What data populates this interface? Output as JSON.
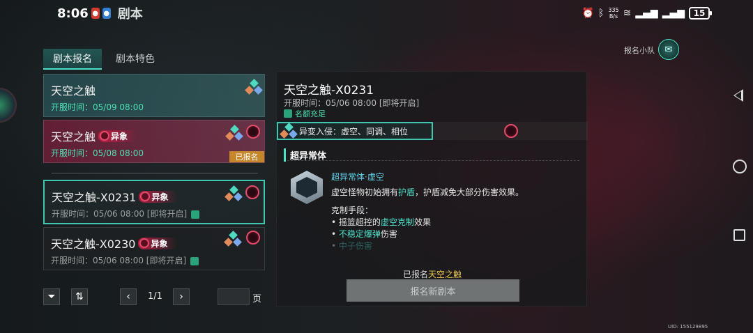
{
  "status_bar": {
    "time": "8:06",
    "net_speed_value": "335",
    "net_speed_unit": "B/s",
    "battery": "15"
  },
  "app": {
    "title": "剧本"
  },
  "tabs": [
    {
      "label": "剧本报名",
      "active": true
    },
    {
      "label": "剧本特色",
      "active": false
    }
  ],
  "scripts": [
    {
      "name": "天空之触",
      "time": "开服时间：05/09 08:00",
      "abnormal": "",
      "registered": ""
    },
    {
      "name": "天空之触",
      "time": "开服时间：05/08 08:00",
      "abnormal": "异象",
      "registered": "已报名"
    },
    {
      "name": "天空之触-X0231",
      "time": "开服时间：05/06 08:00 [即将开启]",
      "abnormal": "异象",
      "registered": ""
    },
    {
      "name": "天空之触-X0230",
      "time": "开服时间：05/06 08:00 [即将开启]",
      "abnormal": "异象",
      "registered": ""
    }
  ],
  "pagination": {
    "current": "1/1",
    "unit": "页"
  },
  "detail": {
    "title": "天空之触-X0231",
    "time": "开服时间：05/06 08:00",
    "status": "[即将开启]",
    "quota": "名额充足",
    "invasion": "异变入侵：虚空、同调、相位",
    "section_title": "超异常体",
    "ability_name": "超异常体·虚空",
    "desc_prefix": "虚空怪物初始拥有",
    "desc_highlight": "护盾",
    "desc_suffix": "，护盾减免大部分伤害效果。",
    "counter_title": "克制手段：",
    "counter_1_prefix": "摇篮超控的",
    "counter_1_highlight": "虚空克制",
    "counter_1_suffix": "效果",
    "counter_2_highlight": "不稳定爆弹",
    "counter_2_suffix": "伤害",
    "counter_3": "中子伤害",
    "registered_prefix": "已报名",
    "registered_name": "天空之触",
    "new_button": "报名新剧本"
  },
  "team": {
    "label": "报名小队"
  },
  "uid": "UID: 155129895",
  "colors": {
    "accent": "#4de0c9",
    "registered_tag": "#c6862a",
    "abnormal": "#e24a6a"
  }
}
